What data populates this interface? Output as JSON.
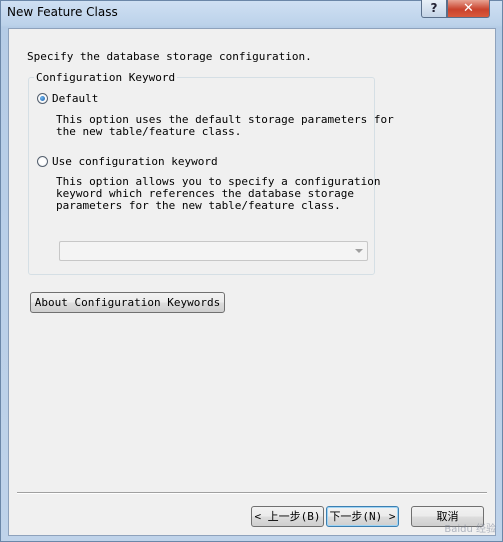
{
  "window": {
    "title": "New Feature Class"
  },
  "titlebar": {
    "help_label": "?",
    "close_label": "✕"
  },
  "instruction": "Specify the database storage configuration.",
  "group": {
    "legend": "Configuration Keyword",
    "options": [
      {
        "label": "Default",
        "selected": true,
        "description": "This option uses the default storage parameters for\nthe new table/feature class."
      },
      {
        "label": "Use configuration keyword",
        "selected": false,
        "description": "This option allows you to specify a configuration\nkeyword which references the database storage\nparameters for the new table/feature class."
      }
    ],
    "keyword_select": {
      "value": "",
      "enabled": false
    }
  },
  "about_button": "About Configuration Keywords",
  "nav": {
    "back_label": "< 上一步(B)",
    "next_label": "下一步(N) >",
    "cancel_label": "取消"
  },
  "watermark": "Baidu 经验"
}
